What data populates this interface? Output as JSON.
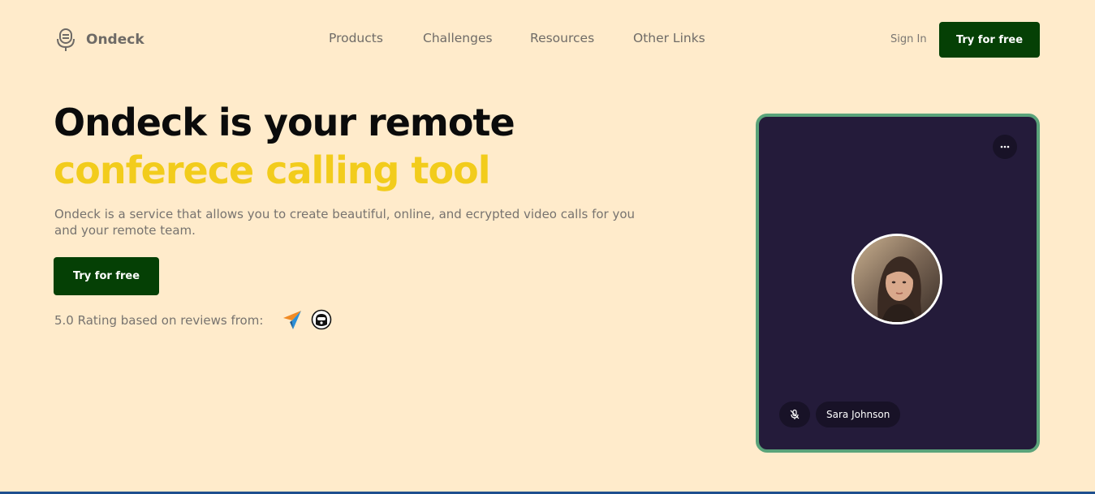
{
  "brand": {
    "name": "Ondeck",
    "logo_icon": "microphone-icon"
  },
  "nav": {
    "items": [
      {
        "label": "Products"
      },
      {
        "label": "Challenges"
      },
      {
        "label": "Resources"
      },
      {
        "label": "Other Links"
      }
    ]
  },
  "header": {
    "signin_label": "Sign In",
    "cta_label": "Try for free"
  },
  "hero": {
    "title_line1": "Ondeck is your remote",
    "title_line2": "conferece calling tool",
    "description": "Ondeck is a service that allows you to create beautiful, online, and ecrypted video calls for you and your remote team.",
    "cta_label": "Try for free",
    "rating_text": "5.0 Rating based on reviews from:",
    "review_icons": [
      "paper-plane-logo-icon",
      "astronaut-logo-icon"
    ]
  },
  "call_card": {
    "more_icon": "more-dots-icon",
    "participant_name": "Sara Johnson",
    "mute_icon": "microphone-muted-icon"
  },
  "colors": {
    "background": "#ffebcb",
    "primary_button": "#054005",
    "highlight_text": "#f2cc1c",
    "card_background": "#241b3a",
    "card_border": "#5aa37a"
  }
}
